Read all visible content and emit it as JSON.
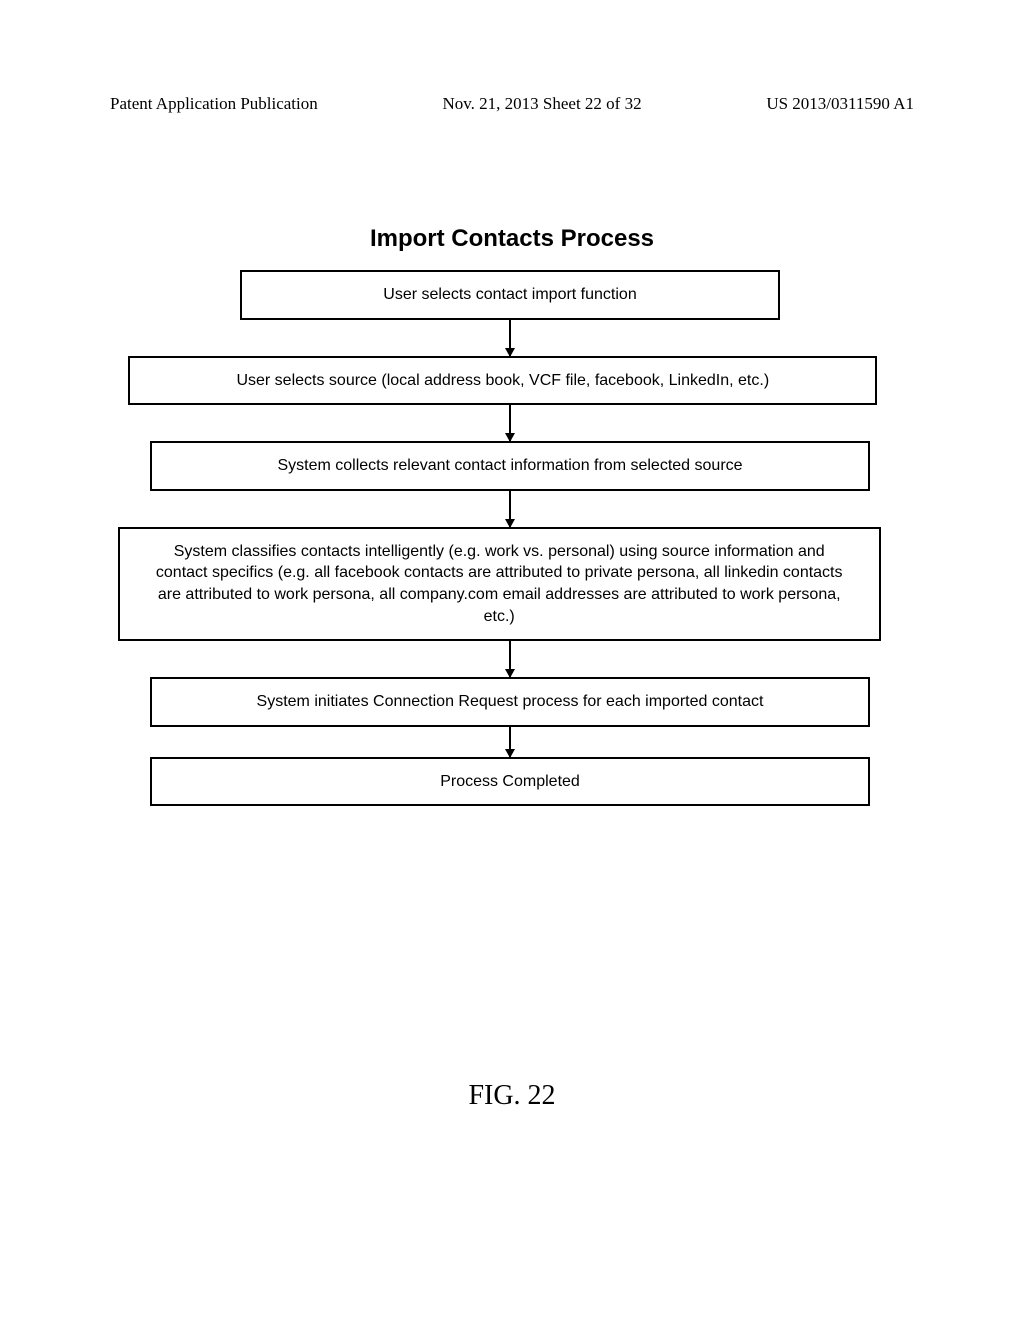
{
  "header": {
    "left": "Patent Application Publication",
    "mid": "Nov. 21, 2013  Sheet 22 of 32",
    "right": "US 2013/0311590 A1"
  },
  "diagram": {
    "title": "Import Contacts Process",
    "steps": [
      "User selects contact import function",
      "User selects source (local address book, VCF file, facebook, LinkedIn, etc.)",
      "System collects relevant contact information from selected source",
      "System classifies contacts intelligently (e.g. work vs. personal) using source information and contact specifics (e.g. all facebook contacts are  attributed to private persona, all linkedin contacts are attributed to  work persona, all company.com email addresses are attributed to work persona, etc.)",
      "System initiates Connection Request process for each imported contact",
      "Process Completed"
    ]
  },
  "figure_label": "FIG. 22"
}
